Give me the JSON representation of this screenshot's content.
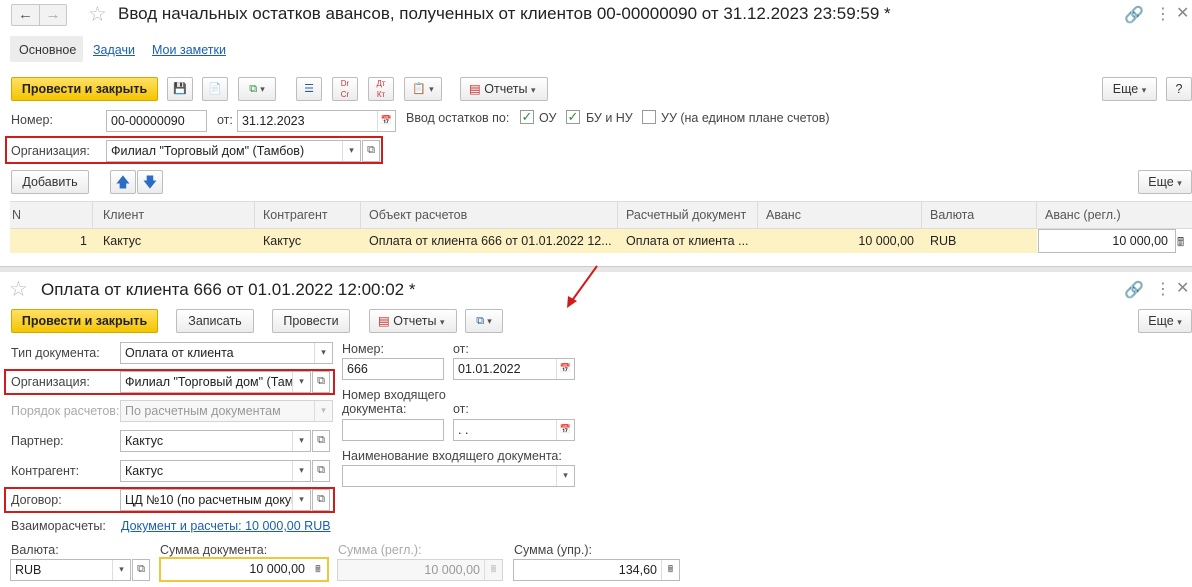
{
  "doc1": {
    "title": "Ввод начальных остатков авансов, полученных от клиентов 00-00000090 от 31.12.2023 23:59:59 *",
    "tabs": [
      "Основное",
      "Задачи",
      "Мои заметки"
    ],
    "toolbar": {
      "post_close": "Провести и закрыть",
      "reports": "Отчеты",
      "more": "Еще",
      "help": "?"
    },
    "number_label": "Номер:",
    "number_value": "00-00000090",
    "date_label": "от:",
    "date_value": "31.12.2023",
    "balances_label": "Ввод остатков по:",
    "chk_ou": "ОУ",
    "chk_bu": "БУ и НУ",
    "chk_uu": "УУ (на едином плане счетов)",
    "org_label": "Организация:",
    "org_value": "Филиал \"Торговый дом\" (Тамбов)",
    "add": "Добавить",
    "table_more": "Еще",
    "columns": [
      "N",
      "Клиент",
      "Контрагент",
      "Объект расчетов",
      "Расчетный документ",
      "Аванс",
      "Валюта",
      "Аванс (регл.)"
    ],
    "row": [
      "1",
      "Кактус",
      "Кактус",
      "Оплата от клиента 666 от 01.01.2022 12...",
      "Оплата от клиента ...",
      "10 000,00",
      "RUB",
      "10 000,00"
    ]
  },
  "doc2": {
    "title": "Оплата от клиента 666 от 01.01.2022 12:00:02 *",
    "toolbar": {
      "post_close": "Провести и закрыть",
      "save": "Записать",
      "post": "Провести",
      "reports": "Отчеты",
      "more": "Еще"
    },
    "doc_type_label": "Тип документа:",
    "doc_type_value": "Оплата от клиента",
    "org_label": "Организация:",
    "org_value": "Филиал \"Торговый дом\" (Тамб",
    "order_label": "Порядок расчетов:",
    "order_value": "По расчетным документам",
    "partner_label": "Партнер:",
    "partner_value": "Кактус",
    "counterparty_label": "Контрагент:",
    "counterparty_value": "Кактус",
    "contract_label": "Договор:",
    "contract_value": "ЦД №10 (по расчетным докум",
    "settlements_label": "Взаиморасчеты:",
    "settlements_link": "Документ и расчеты: 10 000,00 RUB",
    "number_label": "Номер:",
    "number_value": "666",
    "date_label": "от:",
    "date_value": "01.01.2022",
    "incoming_number_label": "Номер входящего документа:",
    "incoming_date_label": "от:",
    "incoming_date_value": " .  .",
    "incoming_name_label": "Наименование входящего документа:",
    "currency_label": "Валюта:",
    "currency_value": "RUB",
    "doc_sum_label": "Сумма документа:",
    "doc_sum_value": "10 000,00",
    "reg_sum_label": "Сумма (регл.):",
    "reg_sum_value": "10 000,00",
    "mgmt_sum_label": "Сумма (упр.):",
    "mgmt_sum_value": "134,60"
  },
  "colors": {
    "highlight": "#fdf2c4",
    "accent": "#f5c500",
    "annotation": "#d21c1c",
    "link": "#1a5fb4"
  }
}
